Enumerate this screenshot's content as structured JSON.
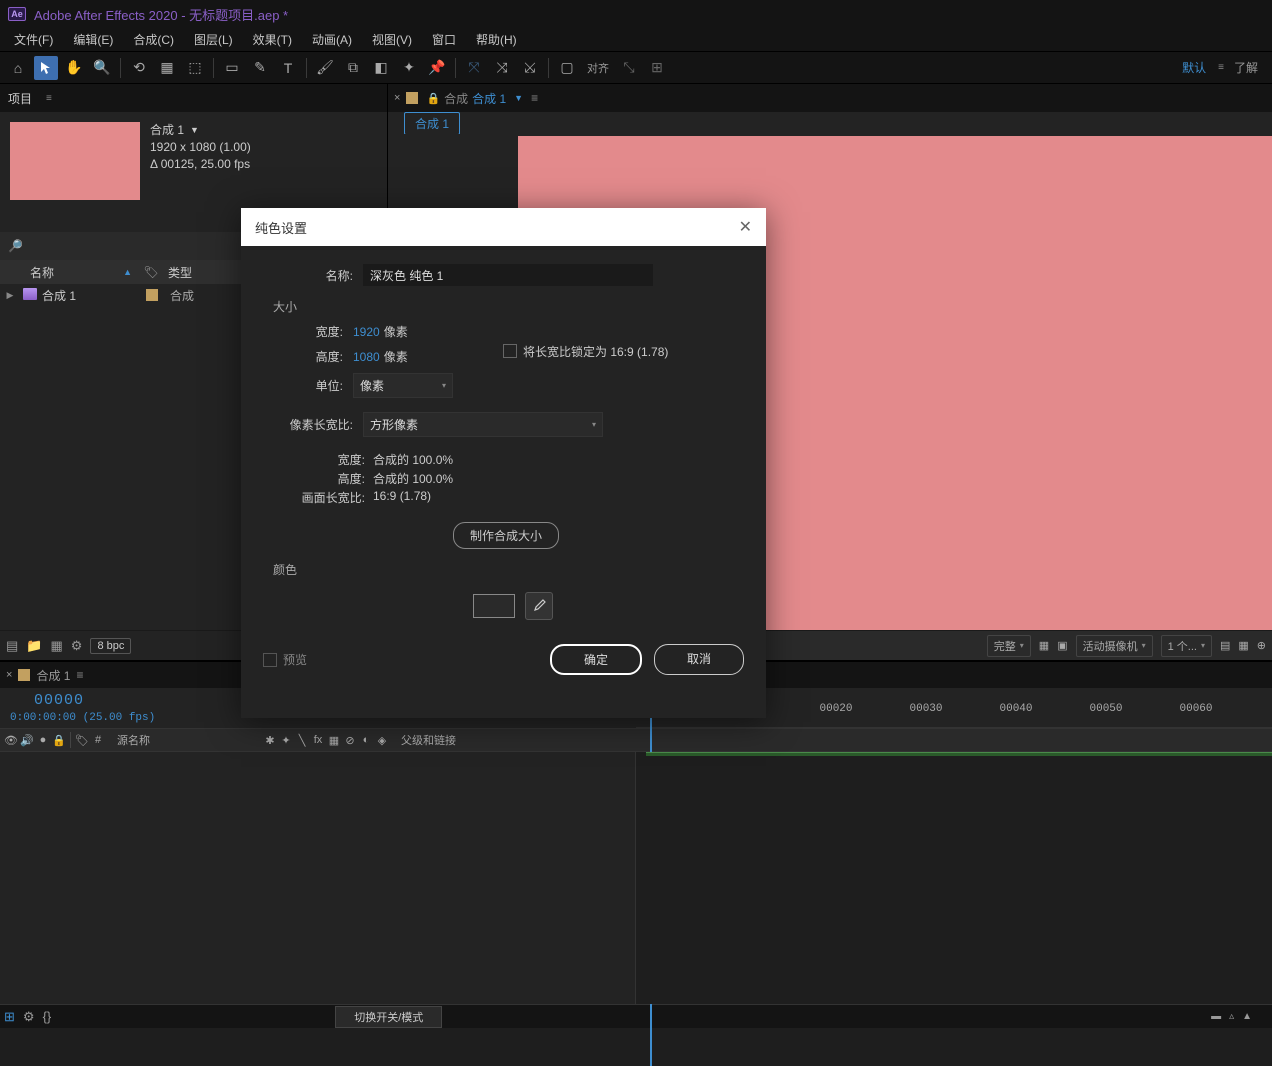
{
  "app": {
    "title": "Adobe After Effects 2020 - 无标题项目.aep *",
    "logo_text": "Ae"
  },
  "menu": {
    "file": "文件(F)",
    "edit": "编辑(E)",
    "composition": "合成(C)",
    "layer": "图层(L)",
    "effect": "效果(T)",
    "animation": "动画(A)",
    "view": "视图(V)",
    "window": "窗口",
    "help": "帮助(H)"
  },
  "toolbar": {
    "align": "对齐",
    "default": "默认",
    "learn": "了解"
  },
  "project": {
    "panel_title": "项目",
    "comp_name": "合成 1",
    "comp_dims": "1920 x 1080 (1.00)",
    "comp_dur": "Δ 00125, 25.00 fps",
    "col_name": "名称",
    "col_type": "类型",
    "row_name": "合成 1",
    "row_type": "合成",
    "bpc": "8 bpc"
  },
  "viewer": {
    "breadcrumb_label": "合成",
    "breadcrumb_name": "合成 1",
    "subtab": "合成 1",
    "footer_res": "完整",
    "footer_cam": "活动摄像机",
    "footer_view": "1 个..."
  },
  "timeline": {
    "tab_name": "合成 1",
    "time_big": "00000",
    "time_small": "0:00:00:00 (25.00 fps)",
    "col_source": "源名称",
    "col_parent": "父级和链接",
    "switch_btn": "切换开关/模式",
    "ticks": [
      "00020",
      "00030",
      "00040",
      "00050",
      "00060"
    ]
  },
  "dialog": {
    "title": "纯色设置",
    "name_label": "名称:",
    "name_value": "深灰色 纯色 1",
    "size_section": "大小",
    "width_label": "宽度:",
    "width_value": "1920",
    "height_label": "高度:",
    "height_value": "1080",
    "px_unit": "像素",
    "lock_aspect": "将长宽比锁定为 16:9 (1.78)",
    "units_label": "单位:",
    "units_value": "像素",
    "par_label": "像素长宽比:",
    "par_value": "方形像素",
    "info_width_label": "宽度:",
    "info_width_val": "合成的 100.0%",
    "info_height_label": "高度:",
    "info_height_val": "合成的 100.0%",
    "info_frame_label": "画面长宽比:",
    "info_frame_val": "16:9 (1.78)",
    "make_comp_size": "制作合成大小",
    "color_section": "颜色",
    "preview": "预览",
    "ok": "确定",
    "cancel": "取消"
  }
}
